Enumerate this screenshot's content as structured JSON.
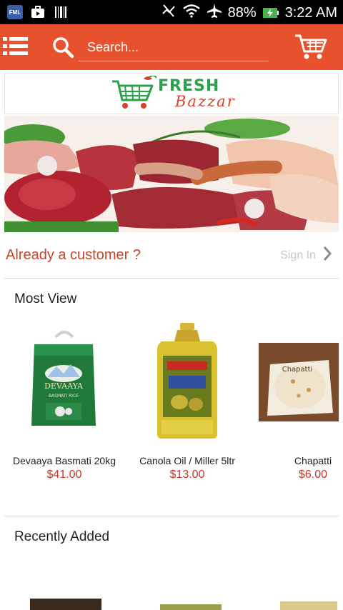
{
  "status_bar": {
    "app_badge": "FML",
    "battery_percent": "88%",
    "time": "3:22 AM"
  },
  "app_bar": {
    "search_placeholder": "Search...",
    "colors": {
      "background": "#e8512d",
      "foreground": "#ffffff"
    },
    "icons": [
      "menu-icon",
      "search-icon",
      "cart-icon"
    ]
  },
  "logo": {
    "word_fresh": "FRESH",
    "word_bazzar": "Bazzar"
  },
  "account": {
    "prompt": "Already a customer ?",
    "sign_in_label": "Sign In"
  },
  "sections": {
    "most_view": "Most View",
    "recently_added": "Recently Added"
  },
  "products": [
    {
      "name": "Devaaya Basmati 20kg",
      "price": "$41.00",
      "image": "rice-bag-image"
    },
    {
      "name": "Canola Oil / Miller 5ltr",
      "price": "$13.00",
      "image": "oil-bottle-image"
    },
    {
      "name": "Chapatti",
      "price": "$6.00",
      "image": "chapatti-pack-image"
    }
  ],
  "product_labels": {
    "rice_brand": "DEVAAYA",
    "rice_type": "BASMATI RICE",
    "chapatti_brand": "Chapatti"
  },
  "accent_price_color": "#c0392b"
}
